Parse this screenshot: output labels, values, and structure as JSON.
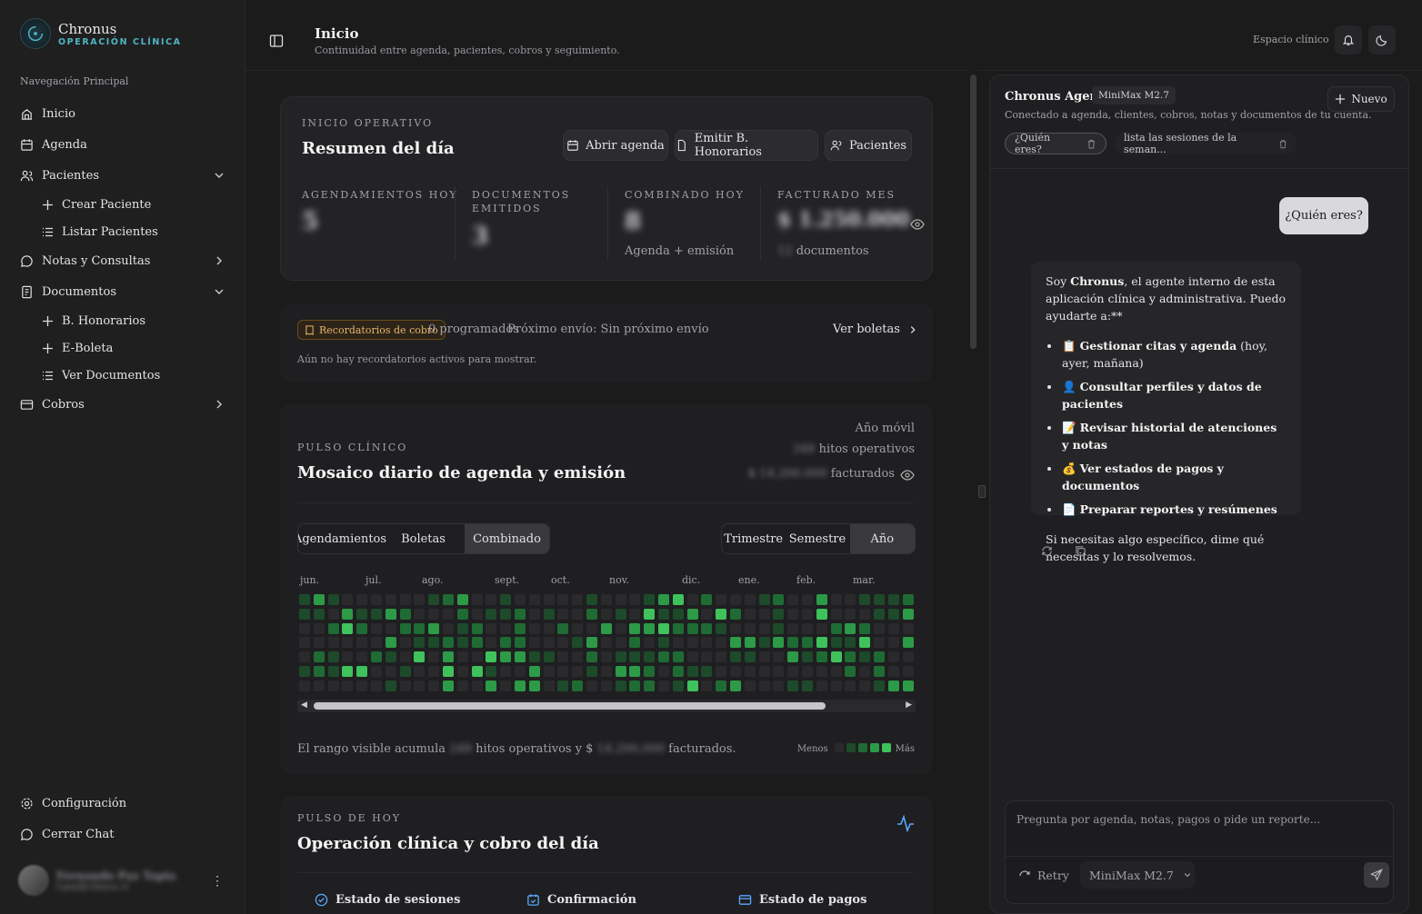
{
  "brand": {
    "name": "Chronus",
    "subtitle": "OPERACIÓN CLÍNICA"
  },
  "sidebar": {
    "heading": "Navegación Principal",
    "items": [
      {
        "label": "Inicio",
        "icon": "home-icon"
      },
      {
        "label": "Agenda",
        "icon": "calendar-icon"
      },
      {
        "label": "Pacientes",
        "icon": "users-icon",
        "expanded": true,
        "children": [
          {
            "label": "Crear Paciente",
            "icon": "plus-icon"
          },
          {
            "label": "Listar Pacientes",
            "icon": "list-icon"
          }
        ]
      },
      {
        "label": "Notas y Consultas",
        "icon": "message-icon",
        "expanded": false
      },
      {
        "label": "Documentos",
        "icon": "document-icon",
        "expanded": true,
        "children": [
          {
            "label": "B. Honorarios",
            "icon": "plus-icon"
          },
          {
            "label": "E-Boleta",
            "icon": "plus-icon"
          },
          {
            "label": "Ver Documentos",
            "icon": "list-icon"
          }
        ]
      },
      {
        "label": "Cobros",
        "icon": "wallet-icon",
        "expanded": false
      }
    ],
    "bottom": [
      {
        "label": "Configuración",
        "icon": "settings-icon"
      },
      {
        "label": "Cerrar Chat",
        "icon": "message-icon"
      }
    ],
    "user": {
      "name": "Fernando Paz Tapia",
      "email": "f.paz@clinica.cl"
    }
  },
  "topbar": {
    "title": "Inicio",
    "subtitle": "Continuidad entre agenda, pacientes, cobros y seguimiento.",
    "space_label": "Espacio clínico"
  },
  "summary": {
    "eyebrow": "INICIO OPERATIVO",
    "title": "Resumen del día",
    "actions": [
      "Abrir agenda",
      "Emitir B. Honorarios",
      "Pacientes"
    ],
    "stats": [
      {
        "label_lines": [
          "AGENDAMIENTOS HOY"
        ],
        "value": "5"
      },
      {
        "label_lines": [
          "DOCUMENTOS",
          "EMITIDOS"
        ],
        "value": "3"
      },
      {
        "label_lines": [
          "COMBINADO HOY"
        ],
        "value": "8",
        "note": "Agenda + emisión"
      },
      {
        "label_lines": [
          "FACTURADO MES"
        ],
        "value": "$ 1.250.000",
        "note_count": "12",
        "note": "documentos"
      }
    ]
  },
  "reminders": {
    "badge": "Recordatorios de cobro",
    "count_text": "0 programados",
    "next_text": "Próximo envío: Sin próximo envío",
    "link": "Ver boletas",
    "empty": "Aún no hay recordatorios activos para mostrar."
  },
  "pulse": {
    "eyebrow": "PULSO CLÍNICO",
    "title": "Mosaico diario de agenda y emisión",
    "period": "Año móvil",
    "hitos_count": "248",
    "hitos_label": "hitos operativos",
    "billed_amount": "$ 14.200.000",
    "billed_label": "facturados",
    "tabs": [
      "Agendamientos",
      "Boletas",
      "Combinado"
    ],
    "active_tab": "Combinado",
    "ranges": [
      "Trimestre",
      "Semestre",
      "Año"
    ],
    "active_range": "Año",
    "months": [
      "jun.",
      "jul.",
      "ago.",
      "sept.",
      "oct.",
      "nov.",
      "dic.",
      "ene.",
      "feb.",
      "mar."
    ],
    "footer_pre": "El rango visible acumula",
    "footer_count": "248",
    "footer_mid": "hitos operativos y $",
    "footer_amount": "14.200.000",
    "footer_post": "facturados.",
    "legend_less": "Menos",
    "legend_more": "Más",
    "palette": [
      "#2a2a2c",
      "#1d4a2a",
      "#1f6b34",
      "#2d9a47",
      "#3fc25c"
    ]
  },
  "today": {
    "eyebrow": "PULSO DE HOY",
    "title": "Operación clínica y cobro del día",
    "cards": [
      "Estado de sesiones",
      "Confirmación",
      "Estado de pagos"
    ]
  },
  "agent": {
    "title": "Chronus Agent",
    "model": "MiniMax M2.7",
    "subtitle": "Conectado a agenda, clientes, cobros, notas y documentos de tu cuenta.",
    "new_label": "Nuevo",
    "chips": [
      "¿Quién eres?",
      "lista las sesiones de la seman..."
    ],
    "user_message": "¿Quién eres?",
    "bot_intro_pre": "Soy ",
    "bot_intro_bold": "Chronus",
    "bot_intro_post": ", el agente interno de esta aplicación clínica y administrativa. Puedo ayudarte a:**",
    "bot_items": [
      {
        "emoji": "📋",
        "bold": "Gestionar citas y agenda",
        "rest": " (hoy, ayer, mañana)"
      },
      {
        "emoji": "👤",
        "bold": "Consultar perfiles y datos de pacientes",
        "rest": ""
      },
      {
        "emoji": "📝",
        "bold": "Revisar historial de atenciones y notas",
        "rest": ""
      },
      {
        "emoji": "💰",
        "bold": "Ver estados de pagos y documentos",
        "rest": ""
      },
      {
        "emoji": "📄",
        "bold": "Preparar reportes y resúmenes",
        "rest": ""
      }
    ],
    "bot_outro": "Si necesitas algo específico, dime qué necesitas y lo resolvemos.",
    "input_placeholder": "Pregunta por agenda, notas, pagos o pide un reporte...",
    "retry_label": "Retry",
    "model_select": "MiniMax M2.7"
  }
}
